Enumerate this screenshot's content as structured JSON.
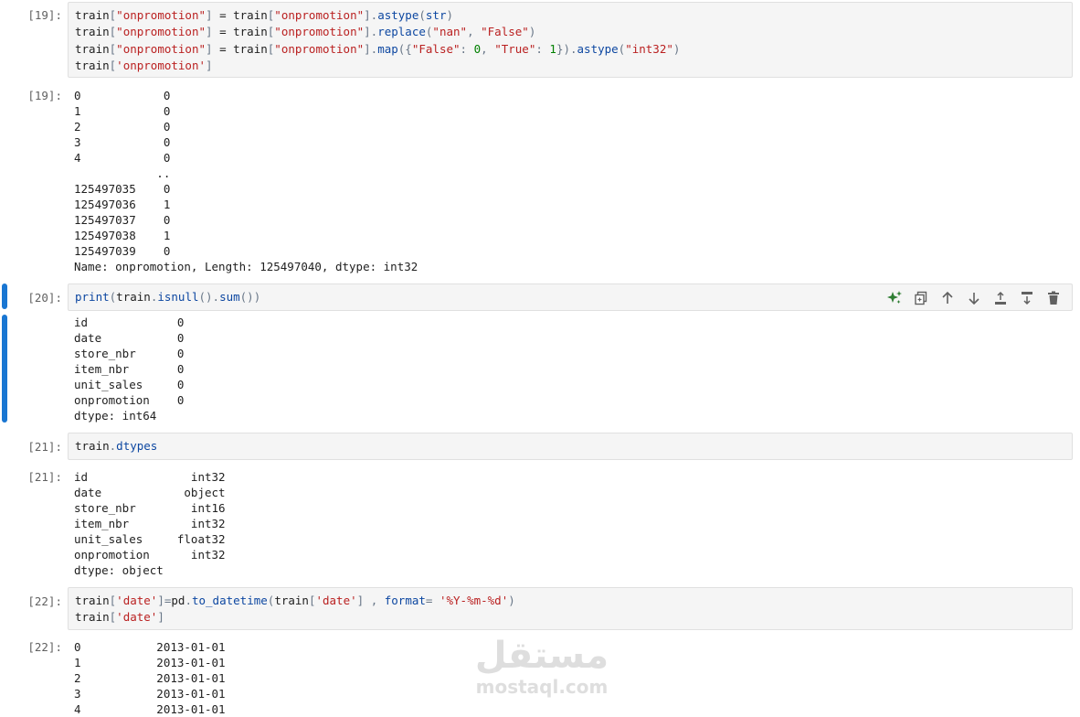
{
  "cells": [
    {
      "prompt_in": "[19]:",
      "prompt_out": "[19]:",
      "code_lines": [
        [
          [
            "v",
            "train"
          ],
          [
            "o",
            "["
          ],
          [
            "s",
            "\"onpromotion\""
          ],
          [
            "o",
            "]"
          ],
          [
            "v",
            " = train"
          ],
          [
            "o",
            "["
          ],
          [
            "s",
            "\"onpromotion\""
          ],
          [
            "o",
            "]."
          ],
          [
            "f",
            "astype"
          ],
          [
            "o",
            "("
          ],
          [
            "f",
            "str"
          ],
          [
            "o",
            ")"
          ]
        ],
        [
          [
            "v",
            "train"
          ],
          [
            "o",
            "["
          ],
          [
            "s",
            "\"onpromotion\""
          ],
          [
            "o",
            "]"
          ],
          [
            "v",
            " = train"
          ],
          [
            "o",
            "["
          ],
          [
            "s",
            "\"onpromotion\""
          ],
          [
            "o",
            "]."
          ],
          [
            "f",
            "replace"
          ],
          [
            "o",
            "("
          ],
          [
            "s",
            "\"nan\""
          ],
          [
            "o",
            ", "
          ],
          [
            "s",
            "\"False\""
          ],
          [
            "o",
            ")"
          ]
        ],
        [
          [
            "v",
            "train"
          ],
          [
            "o",
            "["
          ],
          [
            "s",
            "\"onpromotion\""
          ],
          [
            "o",
            "]"
          ],
          [
            "v",
            " = train"
          ],
          [
            "o",
            "["
          ],
          [
            "s",
            "\"onpromotion\""
          ],
          [
            "o",
            "]."
          ],
          [
            "f",
            "map"
          ],
          [
            "o",
            "({"
          ],
          [
            "s",
            "\"False\""
          ],
          [
            "o",
            ": "
          ],
          [
            "n",
            "0"
          ],
          [
            "o",
            ", "
          ],
          [
            "s",
            "\"True\""
          ],
          [
            "o",
            ": "
          ],
          [
            "n",
            "1"
          ],
          [
            "o",
            "})."
          ],
          [
            "f",
            "astype"
          ],
          [
            "o",
            "("
          ],
          [
            "s",
            "\"int32\""
          ],
          [
            "o",
            ")"
          ]
        ],
        [
          [
            "v",
            "train"
          ],
          [
            "o",
            "["
          ],
          [
            "s",
            "'onpromotion'"
          ],
          [
            "o",
            "]"
          ]
        ]
      ],
      "output": "0            0\n1            0\n2            0\n3            0\n4            0\n            ..\n125497035    0\n125497036    1\n125497037    0\n125497038    1\n125497039    0\nName: onpromotion, Length: 125497040, dtype: int32"
    },
    {
      "prompt_in": "[20]:",
      "prompt_out": "",
      "code_lines": [
        [
          [
            "f",
            "print"
          ],
          [
            "o",
            "("
          ],
          [
            "v",
            "train"
          ],
          [
            "o",
            "."
          ],
          [
            "f",
            "isnull"
          ],
          [
            "o",
            "()."
          ],
          [
            "f",
            "sum"
          ],
          [
            "o",
            "())"
          ]
        ]
      ],
      "output": "id             0\ndate           0\nstore_nbr      0\nitem_nbr       0\nunit_sales     0\nonpromotion    0\ndtype: int64"
    },
    {
      "prompt_in": "[21]:",
      "prompt_out": "[21]:",
      "code_lines": [
        [
          [
            "v",
            "train"
          ],
          [
            "o",
            "."
          ],
          [
            "f",
            "dtypes"
          ]
        ]
      ],
      "output": "id               int32\ndate            object\nstore_nbr        int16\nitem_nbr         int32\nunit_sales     float32\nonpromotion      int32\ndtype: object"
    },
    {
      "prompt_in": "[22]:",
      "prompt_out": "[22]:",
      "code_lines": [
        [
          [
            "v",
            "train"
          ],
          [
            "o",
            "["
          ],
          [
            "s",
            "'date'"
          ],
          [
            "o",
            "]="
          ],
          [
            "v",
            "pd"
          ],
          [
            "o",
            "."
          ],
          [
            "f",
            "to_datetime"
          ],
          [
            "o",
            "("
          ],
          [
            "v",
            "train"
          ],
          [
            "o",
            "["
          ],
          [
            "s",
            "'date'"
          ],
          [
            "o",
            "] , "
          ],
          [
            "f",
            "format"
          ],
          [
            "o",
            "= "
          ],
          [
            "s",
            "'%Y-%m-%d'"
          ],
          [
            "o",
            ")"
          ]
        ],
        [
          [
            "v",
            "train"
          ],
          [
            "o",
            "["
          ],
          [
            "s",
            "'date'"
          ],
          [
            "o",
            "]"
          ]
        ]
      ],
      "output": "0           2013-01-01\n1           2013-01-01\n2           2013-01-01\n3           2013-01-01\n4           2013-01-01"
    }
  ],
  "toolbar": {
    "icons": [
      "sparkle-icon",
      "duplicate-icon",
      "move-up-icon",
      "move-down-icon",
      "insert-above-icon",
      "insert-below-icon",
      "delete-icon"
    ],
    "accent": "#2e7d32"
  },
  "watermark": {
    "arabic": "مستقل",
    "latin": "mostaql.com"
  },
  "colors": {
    "selection": "#1976d2",
    "string": "#ba2121",
    "function": "#0d47a1",
    "number": "#008000"
  }
}
